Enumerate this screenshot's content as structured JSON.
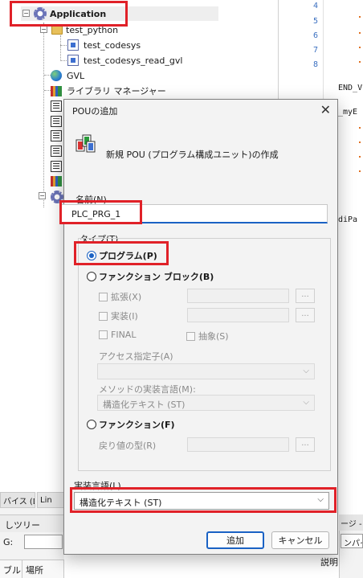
{
  "tree": {
    "application_label": "Application",
    "test_python_label": "test_python",
    "test_codesys_label": "test_codesys",
    "test_codesys_read_gvl_label": "test_codesys_read_gvl",
    "gvl_label": "GVL",
    "library_manager_label": "ライブラリ マネージャー"
  },
  "code_pane": {
    "line_numbers": [
      "4",
      "5",
      "6",
      "7",
      "8"
    ],
    "end_var_text": "END_V",
    "myvar_text": "_myE",
    "dipar_text": "diPa"
  },
  "bottom": {
    "devices_tab": "バイス (D)",
    "second_tab": "Lin",
    "tree_header": "しツリー",
    "g_label": "G:",
    "col1": "ブル",
    "col2": "場所",
    "right_title": "ージ -",
    "right_tab": "ンパイル",
    "right_desc": "説明"
  },
  "dialog": {
    "title": "POUの追加",
    "header_text": "新規 POU (プログラム構成ユニット)の作成",
    "name_label": "名前(N)",
    "name_value": "PLC_PRG_1",
    "type_label": "タイプ(T)",
    "radio_program": "プログラム(P)",
    "radio_function_block": "ファンクション ブロック(B)",
    "check_extends": "拡張(X)",
    "check_implements": "実装(I)",
    "check_final": "FINAL",
    "check_abstract": "抽象(S)",
    "browse": "...",
    "access_label": "アクセス指定子(A)",
    "method_lang_label": "メソッドの実装言語(M):",
    "method_lang_value": "構造化テキスト (ST)",
    "radio_function": "ファンクション(F)",
    "return_type_label": "戻り値の型(R)",
    "impl_lang_label": "実装言語(L)",
    "impl_lang_value": "構造化テキスト (ST)",
    "ok_button": "追加",
    "cancel_button": "キャンセル",
    "selected_type": "program"
  },
  "colors": {
    "highlight": "#e02128",
    "accent": "#1a62c4"
  }
}
